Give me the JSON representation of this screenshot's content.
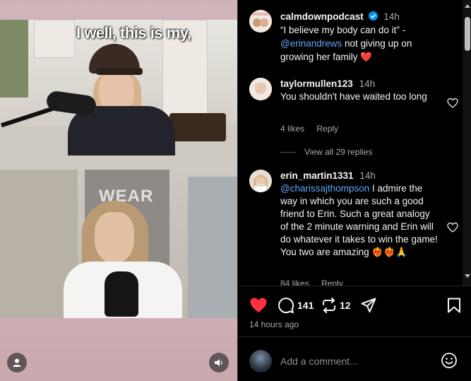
{
  "video": {
    "caption": "I well, this is my,",
    "bottom_sign": "WEAR",
    "user_icon": "user-icon",
    "volume_icon": "volume-icon"
  },
  "post": {
    "username": "calmdownpodcast",
    "time": "14h",
    "text_line1": "“I believe my body can do it” -",
    "mention": "@erinandrews",
    "text_rest": " not giving up on growing her family ",
    "heart": "❤️"
  },
  "comments": [
    {
      "username": "taylormullen123",
      "time": "14h",
      "text": "You shouldn't have waited too long",
      "likes": "4 likes",
      "reply": "Reply"
    },
    {
      "username": "erin_martin1331",
      "time": "14h",
      "mention": "@charissajthompson",
      "text": " I admire the way in which you are such a good friend to Erin. Such a great analogy of the 2 minute warning and Erin will do whatever it takes to win the game! You two are amazing ",
      "emojis": "❤️‍🔥❤️‍🔥🙏",
      "likes": "84 likes",
      "reply": "Reply"
    }
  ],
  "view_replies": "View all 29 replies",
  "actions": {
    "like_icon": "heart-icon",
    "comment_icon": "comment-icon",
    "comment_count": "141",
    "repost_icon": "repost-icon",
    "repost_count": "12",
    "share_icon": "share-icon",
    "save_icon": "bookmark-icon",
    "like_color": "#ff3040"
  },
  "posted_time": "14 hours ago",
  "add_comment": {
    "placeholder": "Add a comment...",
    "emoji_icon": "emoji-icon"
  }
}
